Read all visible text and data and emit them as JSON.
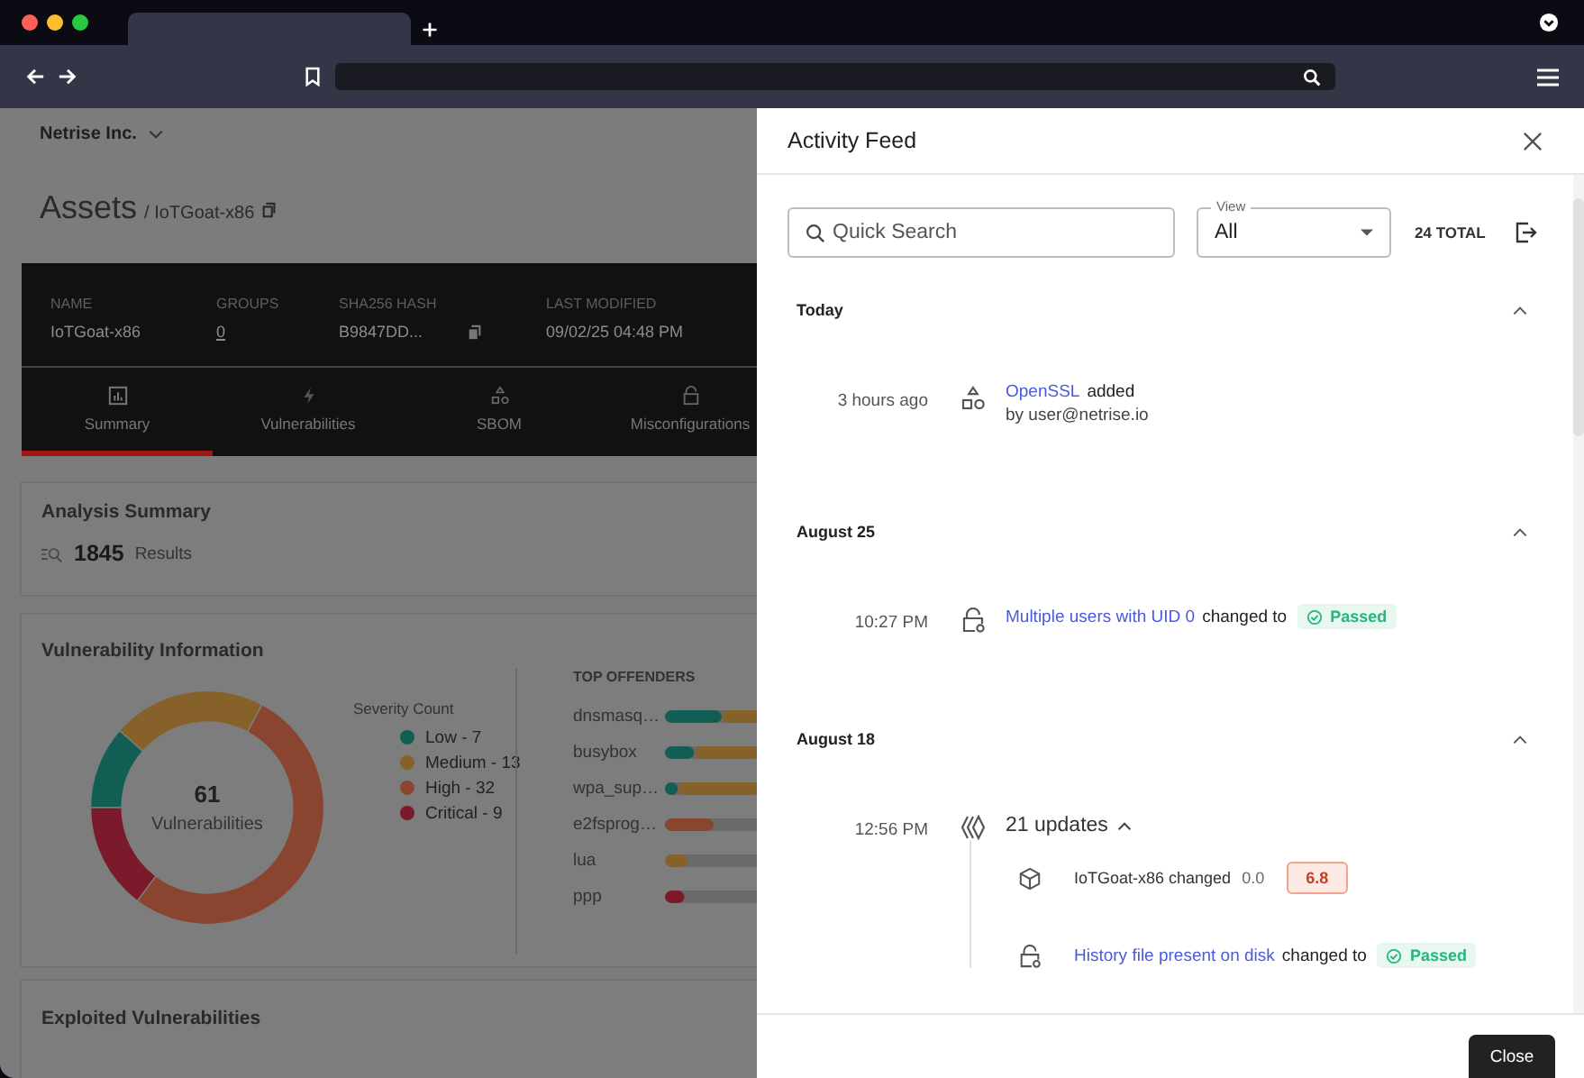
{
  "page": {
    "org": "Netrise Inc.",
    "title": "Assets",
    "breadcrumb": "/ IoTGoat-x86",
    "asset": [
      {
        "label": "NAME",
        "value": "IoTGoat-x86",
        "kind": "text"
      },
      {
        "label": "GROUPS",
        "value": "0",
        "kind": "link"
      },
      {
        "label": "SHA256 HASH",
        "value": "B9847DD...",
        "kind": "copy"
      },
      {
        "label": "LAST MODIFIED",
        "value": "09/02/25 04:48 PM",
        "kind": "text"
      }
    ],
    "tabs": [
      {
        "label": "Summary",
        "kind": "chart",
        "selected": true
      },
      {
        "label": "Vulnerabilities",
        "kind": "bolt",
        "selected": false
      },
      {
        "label": "SBOM",
        "kind": "shapes",
        "selected": false
      },
      {
        "label": "Misconfigurations",
        "kind": "lock",
        "selected": false
      }
    ],
    "analysis": {
      "title": "Analysis Summary",
      "count": "1845",
      "unit": "Results"
    },
    "vulnerability": {
      "title": "Vulnerability Information",
      "total": "61",
      "total_label": "Vulnerabilities",
      "chart_data": {
        "type": "donut",
        "categories": [
          "Low - 7",
          "Medium - 13",
          "High - 32",
          "Critical - 9"
        ],
        "series": [
          {
            "name": "Severity Count",
            "values": [
              11.48,
              21.31,
              52.46,
              14.75
            ]
          }
        ]
      },
      "legend": [
        {
          "color": "#135e54"
        },
        {
          "color": "#86622a"
        },
        {
          "color": "#8a4530"
        },
        {
          "color": "#7a1a2a"
        }
      ],
      "offenders_title": "TOP OFFENDERS",
      "offenders": [
        "dnsmasq…",
        "busybox",
        "wpa_sup…",
        "e2fsprog…",
        "lua",
        "ppp"
      ]
    },
    "exploited": {
      "title": "Exploited Vulnerabilities"
    }
  },
  "drawer": {
    "title": "Activity Feed",
    "search": {
      "placeholder": "Quick Search"
    },
    "view": {
      "label": "View",
      "value": "All"
    },
    "total": "24 TOTAL",
    "groups": [
      {
        "date": "Today",
        "expanded": true,
        "entries": [
          {
            "time": "3 hours ago",
            "kind": "sbom",
            "link": "OpenSSL",
            "text": "added",
            "by": "by user@netrise.io"
          }
        ]
      },
      {
        "date": "August 25",
        "expanded": true,
        "entries": [
          {
            "time": "10:27 PM",
            "kind": "misconfiguration",
            "link": "Multiple users with UID 0",
            "text": "changed to",
            "badge": {
              "kind": "passed",
              "label": "Passed"
            }
          }
        ]
      },
      {
        "date": "August 18",
        "expanded": true,
        "entries": [
          {
            "time": "12:56 PM",
            "kind": "updates",
            "summary": "21 updates",
            "expanded": true,
            "children": [
              {
                "kind": "asset",
                "subject": "IoTGoat-x86 changed",
                "from": "0.0",
                "badge": {
                  "kind": "score",
                  "label": "6.8"
                }
              },
              {
                "kind": "misconfiguration",
                "link": "History file present on disk",
                "text": "changed to",
                "badge": {
                  "kind": "passed",
                  "label": "Passed"
                }
              }
            ]
          }
        ]
      }
    ],
    "close": "Close"
  }
}
